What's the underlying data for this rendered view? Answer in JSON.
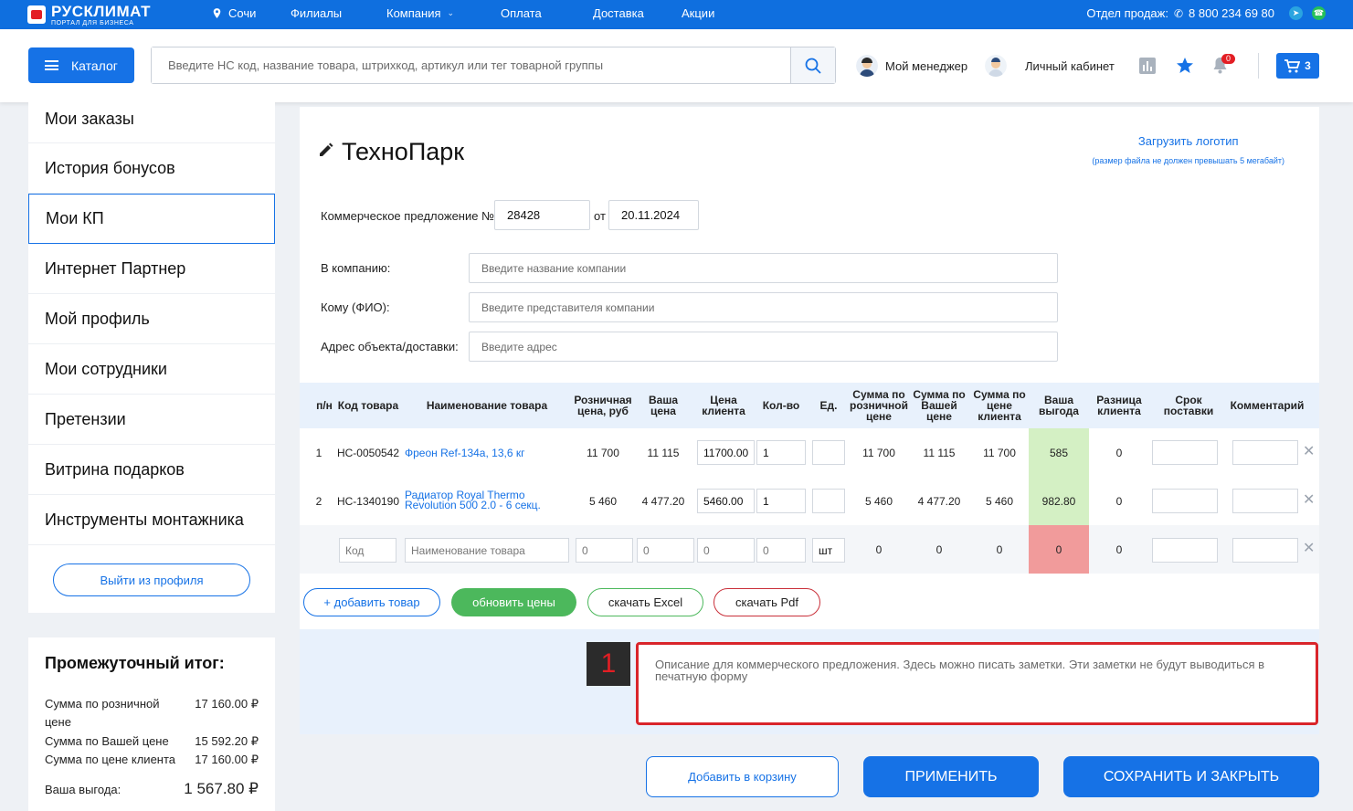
{
  "topbar": {
    "brand": "РУСКЛИМАТ",
    "brand_sub": "ПОРТАЛ ДЛЯ БИЗНЕСА",
    "city": "Сочи",
    "nav": [
      "Филиалы",
      "Компания",
      "Оплата",
      "Доставка",
      "Акции"
    ],
    "sales_label": "Отдел продаж:",
    "phone": "8 800 234 69 80",
    "accent": "#0f6fdf"
  },
  "header": {
    "catalog_label": "Каталог",
    "search_placeholder": "Введите НС код, название товара, штрихкод, артикул или тег товарной группы",
    "manager_label": "Мой менеджер",
    "account_label": "Личный кабинет",
    "notifications_count": "0",
    "cart_count": "3"
  },
  "sidebar": {
    "items": [
      "Мои заказы",
      "История бонусов",
      "Мои КП",
      "Интернет Партнер",
      "Мой профиль",
      "Мои сотрудники",
      "Претензии",
      "Витрина подарков",
      "Инструменты монтажника"
    ],
    "active_index": 2,
    "logout_label": "Выйти из профиля"
  },
  "summary": {
    "title": "Промежуточный итог:",
    "retail_label_1": "Сумма по розничной",
    "retail_label_2": "цене",
    "retail_value": "17 160.00 ₽",
    "your_label": "Сумма по Вашей цене",
    "your_value": "15 592.20 ₽",
    "client_label": "Сумма по цене клиента",
    "client_value": "17 160.00 ₽",
    "benefit_label": "Ваша выгода:",
    "benefit_value": "1 567.80 ₽"
  },
  "offer": {
    "title": "ТехноПарк",
    "upload_label": "Загрузить логотип",
    "upload_hint": "(размер файла не должен превышать 5 мегабайт)",
    "number_label": "Коммерческое предложение №",
    "number": "28428",
    "date_label": "от",
    "date": "20.11.2024",
    "company_label": "В компанию:",
    "company_placeholder": "Введите название компании",
    "to_label": "Кому (ФИО):",
    "to_placeholder": "Введите представителя компании",
    "address_label": "Адрес объекта/доставки:",
    "address_placeholder": "Введите адрес"
  },
  "table": {
    "headers": {
      "n": "п/н",
      "code": "Код товара",
      "name": "Наименование товара",
      "retail_1": "Розничная",
      "retail_2": "цена, руб",
      "your_1": "Ваша",
      "your_2": "цена",
      "client_1": "Цена",
      "client_2": "клиента",
      "qty": "Кол-во",
      "unit": "Ед.",
      "sum_retail_1": "Сумма по",
      "sum_retail_2": "розничной",
      "sum_retail_3": "цене",
      "sum_your_1": "Сумма по",
      "sum_your_2": "Вашей",
      "sum_your_3": "цене",
      "sum_client_1": "Сумма по",
      "sum_client_2": "цене",
      "sum_client_3": "клиента",
      "benefit_1": "Ваша",
      "benefit_2": "выгода",
      "diff_1": "Разница",
      "diff_2": "клиента",
      "delivery_1": "Срок",
      "delivery_2": "поставки",
      "comment": "Комментарий"
    },
    "rows": [
      {
        "n": "1",
        "code": "НС-0050542",
        "name_1": "Фреон Ref-134a, 13,6 кг",
        "name_2": "",
        "retail": "11 700",
        "your": "11 115",
        "client": "11700.00",
        "qty": "1",
        "unit": "",
        "sum_retail": "11 700",
        "sum_your": "11 115",
        "sum_client": "11 700",
        "benefit": "585",
        "diff": "0"
      },
      {
        "n": "2",
        "code": "НС-1340190",
        "name_1": "Радиатор Royal Thermo",
        "name_2": "Revolution 500 2.0 - 6 секц.",
        "retail": "5 460",
        "your": "4 477.20",
        "client": "5460.00",
        "qty": "1",
        "unit": "",
        "sum_retail": "5 460",
        "sum_your": "4 477.20",
        "sum_client": "5 460",
        "benefit": "982.80",
        "diff": "0"
      }
    ],
    "new_row": {
      "code_placeholder": "Код",
      "name_placeholder": "Наименование товара",
      "retail": "0",
      "your": "0",
      "client": "0",
      "qty": "0",
      "unit": "шт",
      "sum_retail": "0",
      "sum_your": "0",
      "sum_client": "0",
      "benefit": "0",
      "diff": "0"
    },
    "benefit_positive_color": "#d4f0c4",
    "benefit_zero_color": "#f19b9b"
  },
  "actions": {
    "add_product": "+ добавить товар",
    "update_prices": "обновить цены",
    "download_excel": "скачать Excel",
    "download_pdf": "скачать Pdf"
  },
  "note": {
    "badge": "1",
    "placeholder": "Описание для коммерческого предложения. Здесь можно писать заметки. Эти заметки не будут выводиться в печатную форму"
  },
  "footer_actions": {
    "add_to_cart": "Добавить в корзину",
    "apply": "ПРИМЕНИТЬ",
    "save_close": "СОХРАНИТЬ И ЗАКРЫТЬ"
  }
}
